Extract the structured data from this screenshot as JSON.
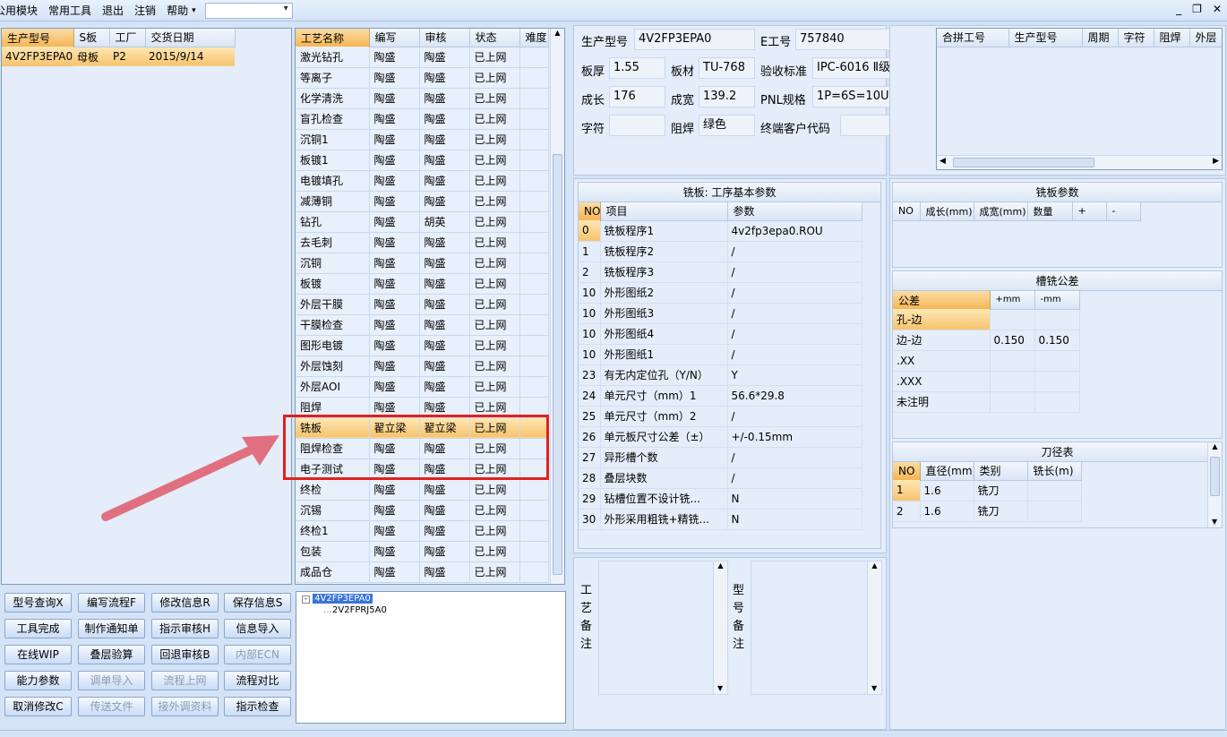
{
  "menu": {
    "items": [
      "公用模块",
      "常用工具",
      "退出",
      "注销",
      "帮助"
    ],
    "combo_value": ""
  },
  "left_table": {
    "columns": [
      "生产型号",
      "S板",
      "工厂",
      "交货日期"
    ],
    "rows": [
      [
        "4V2FP3EPA0",
        "母板",
        "P2",
        "2015/9/14"
      ]
    ]
  },
  "process_table": {
    "columns": [
      "工艺名称",
      "编写",
      "审核",
      "状态",
      "难度"
    ],
    "rows": [
      [
        "激光钻孔",
        "陶盛",
        "陶盛",
        "已上网",
        ""
      ],
      [
        "等离子",
        "陶盛",
        "陶盛",
        "已上网",
        ""
      ],
      [
        "化学清洗",
        "陶盛",
        "陶盛",
        "已上网",
        ""
      ],
      [
        "盲孔检查",
        "陶盛",
        "陶盛",
        "已上网",
        ""
      ],
      [
        "沉铜1",
        "陶盛",
        "陶盛",
        "已上网",
        ""
      ],
      [
        "板镀1",
        "陶盛",
        "陶盛",
        "已上网",
        ""
      ],
      [
        "电镀填孔",
        "陶盛",
        "陶盛",
        "已上网",
        ""
      ],
      [
        "减薄铜",
        "陶盛",
        "陶盛",
        "已上网",
        ""
      ],
      [
        "钻孔",
        "陶盛",
        "胡英",
        "已上网",
        ""
      ],
      [
        "去毛刺",
        "陶盛",
        "陶盛",
        "已上网",
        ""
      ],
      [
        "沉铜",
        "陶盛",
        "陶盛",
        "已上网",
        ""
      ],
      [
        "板镀",
        "陶盛",
        "陶盛",
        "已上网",
        ""
      ],
      [
        "外层干膜",
        "陶盛",
        "陶盛",
        "已上网",
        ""
      ],
      [
        "干膜检查",
        "陶盛",
        "陶盛",
        "已上网",
        ""
      ],
      [
        "图形电镀",
        "陶盛",
        "陶盛",
        "已上网",
        ""
      ],
      [
        "外层蚀刻",
        "陶盛",
        "陶盛",
        "已上网",
        ""
      ],
      [
        "外层AOI",
        "陶盛",
        "陶盛",
        "已上网",
        ""
      ],
      [
        "阻焊",
        "陶盛",
        "陶盛",
        "已上网",
        ""
      ],
      [
        "铣板",
        "翟立梁",
        "翟立梁",
        "已上网",
        ""
      ],
      [
        "阻焊检查",
        "陶盛",
        "陶盛",
        "已上网",
        ""
      ],
      [
        "电子测试",
        "陶盛",
        "陶盛",
        "已上网",
        ""
      ],
      [
        "终检",
        "陶盛",
        "陶盛",
        "已上网",
        ""
      ],
      [
        "沉锡",
        "陶盛",
        "陶盛",
        "已上网",
        ""
      ],
      [
        "终检1",
        "陶盛",
        "陶盛",
        "已上网",
        ""
      ],
      [
        "包装",
        "陶盛",
        "陶盛",
        "已上网",
        ""
      ],
      [
        "成品仓",
        "陶盛",
        "陶盛",
        "已上网",
        ""
      ]
    ]
  },
  "buttons": [
    "型号查询X",
    "编写流程F",
    "修改信息R",
    "保存信息S",
    "工具完成",
    "制作通知单",
    "指示审核H",
    "信息导入",
    "在线WIP",
    "叠层验算",
    "回退审核B",
    "内部ECN",
    "能力参数",
    "调单导入",
    "流程上网",
    "流程对比",
    "取消修改C",
    "传送文件",
    "接外调资料",
    "指示检查"
  ],
  "tree": {
    "root": "4V2FP3EPA0",
    "child": "2V2FPRJ5A0"
  },
  "info": {
    "model_label": "生产型号",
    "model": "4V2FP3EPA0",
    "eno_label": "E工号",
    "eno": "757840",
    "thick_label": "板厚",
    "thick": "1.55",
    "material_label": "板材",
    "material": "TU-768",
    "std_label": "验收标准",
    "std": "IPC-6016 Ⅱ级",
    "len_label": "成长",
    "len": "176",
    "wid_label": "成宽",
    "wid": "139.2",
    "pnl_label": "PNL规格",
    "pnl": "1P=6S=10U",
    "char_label": "字符",
    "char": "",
    "mask_label": "阻焊",
    "mask": "绿色",
    "cust_label": "终端客户代码",
    "cust": ""
  },
  "merge_table": {
    "columns": [
      "合拼工号",
      "生产型号",
      "周期",
      "字符",
      "阻焊",
      "外层"
    ]
  },
  "mill_params": {
    "title": "铣板: 工序基本参数",
    "columns": [
      "NO",
      "项目",
      "参数"
    ],
    "rows": [
      [
        "0",
        "铣板程序1",
        "4v2fp3epa0.ROU"
      ],
      [
        "1",
        "铣板程序2",
        "/"
      ],
      [
        "2",
        "铣板程序3",
        "/"
      ],
      [
        "10",
        "外形图纸2",
        "/"
      ],
      [
        "10",
        "外形图纸3",
        "/"
      ],
      [
        "10",
        "外形图纸4",
        "/"
      ],
      [
        "10",
        "外形图纸1",
        "/"
      ],
      [
        "23",
        "有无内定位孔（Y/N）",
        "Y"
      ],
      [
        "24",
        "单元尺寸（mm）1",
        "56.6*29.8"
      ],
      [
        "25",
        "单元尺寸（mm）2",
        "/"
      ],
      [
        "26",
        "单元板尺寸公差（±）",
        "+/-0.15mm"
      ],
      [
        "27",
        "异形槽个数",
        "/"
      ],
      [
        "28",
        "叠层块数",
        "/"
      ],
      [
        "29",
        "钻槽位置不设计铣...",
        "N"
      ],
      [
        "30",
        "外形采用粗铣+精铣...",
        "N"
      ]
    ]
  },
  "mill_board": {
    "title": "铣板参数",
    "columns": [
      "NO",
      "成长(mm)",
      "成宽(mm)",
      "数量",
      "+",
      "-"
    ]
  },
  "slot_tol": {
    "title": "槽铣公差",
    "columns": [
      "公差",
      "+mm",
      "-mm"
    ],
    "rows": [
      [
        "孔-边",
        "",
        ""
      ],
      [
        "边-边",
        "0.150",
        "0.150"
      ],
      [
        ".XX",
        "",
        ""
      ],
      [
        ".XXX",
        "",
        ""
      ],
      [
        "未注明",
        "",
        ""
      ]
    ]
  },
  "tool_table": {
    "title": "刀径表",
    "columns": [
      "NO",
      "直径(mm)",
      "类别",
      "铣长(m)"
    ],
    "rows": [
      [
        "1",
        "1.6",
        "铣刀",
        ""
      ],
      [
        "2",
        "1.6",
        "铣刀",
        ""
      ]
    ]
  },
  "notes": {
    "process_label": "工艺备注",
    "model_label": "型号备注"
  },
  "colors": {
    "highlight_box": "#e02020",
    "arrow": "#e07080",
    "selected_row": "#f7c36c"
  }
}
